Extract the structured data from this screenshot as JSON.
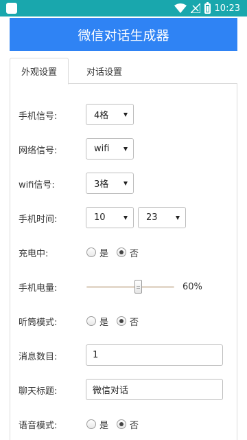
{
  "status_bar": {
    "time": "10:23"
  },
  "header": {
    "title": "微信对话生成器"
  },
  "tabs": [
    {
      "label": "外观设置",
      "active": true
    },
    {
      "label": "对话设置",
      "active": false
    }
  ],
  "form": {
    "signal": {
      "label": "手机信号:",
      "value": "4格"
    },
    "network": {
      "label": "网络信号:",
      "value": "wifi"
    },
    "wifi_signal": {
      "label": "wifi信号:",
      "value": "3格"
    },
    "phone_time": {
      "label": "手机时间:",
      "hour": "10",
      "minute": "23"
    },
    "charging": {
      "label": "充电中:",
      "yes": "是",
      "no": "否",
      "selected": "no"
    },
    "battery": {
      "label": "手机电量:",
      "value": 60,
      "display": "60%"
    },
    "earpiece": {
      "label": "听筒模式:",
      "yes": "是",
      "no": "否",
      "selected": "no"
    },
    "message_count": {
      "label": "消息数目:",
      "value": "1"
    },
    "chat_title": {
      "label": "聊天标题:",
      "value": "微信对话"
    },
    "voice_mode": {
      "label": "语音模式:",
      "yes": "是",
      "no": "否",
      "selected": "no"
    }
  },
  "colors": {
    "status_bar": "#19a7ad",
    "header": "#2f83f4"
  }
}
